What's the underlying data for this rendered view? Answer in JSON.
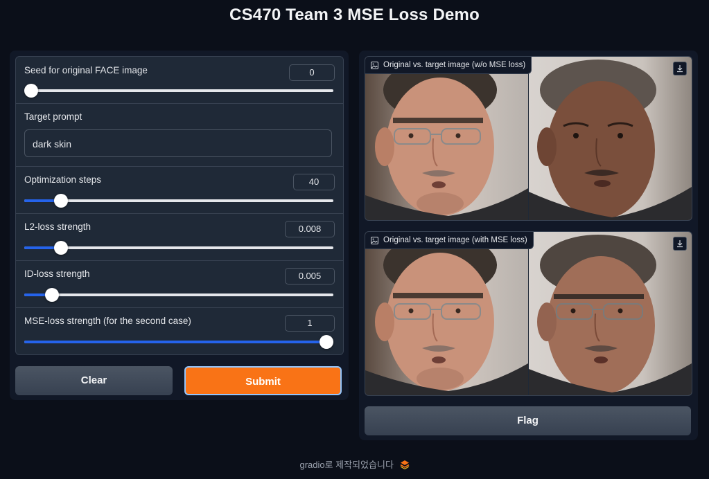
{
  "app": {
    "title": "CS470 Team 3 MSE Loss Demo"
  },
  "inputs": {
    "seed": {
      "label": "Seed for original FACE image",
      "value": "0",
      "fraction": 0.0
    },
    "prompt": {
      "label": "Target prompt",
      "value": "dark skin"
    },
    "steps": {
      "label": "Optimization steps",
      "value": "40",
      "fraction": 0.1
    },
    "l2": {
      "label": "L2-loss strength",
      "value": "0.008",
      "fraction": 0.1
    },
    "id": {
      "label": "ID-loss strength",
      "value": "0.005",
      "fraction": 0.07
    },
    "mse": {
      "label": "MSE-loss strength (for the second case)",
      "value": "1",
      "fraction": 1.0
    }
  },
  "buttons": {
    "clear": "Clear",
    "submit": "Submit",
    "flag": "Flag"
  },
  "outputs": {
    "without_mse": {
      "label": "Original vs. target image (w/o MSE loss)"
    },
    "with_mse": {
      "label": "Original vs. target image (with MSE loss)"
    }
  },
  "footer": {
    "text": "gradio로 제작되었습니다"
  },
  "colors": {
    "accent": "#f97316",
    "slider": "#2563eb",
    "background": "#0b0f19",
    "panel": "#111827"
  },
  "icons": {
    "image_label": "image-icon",
    "download": "download-icon",
    "gradio": "gradio-logo-icon"
  }
}
